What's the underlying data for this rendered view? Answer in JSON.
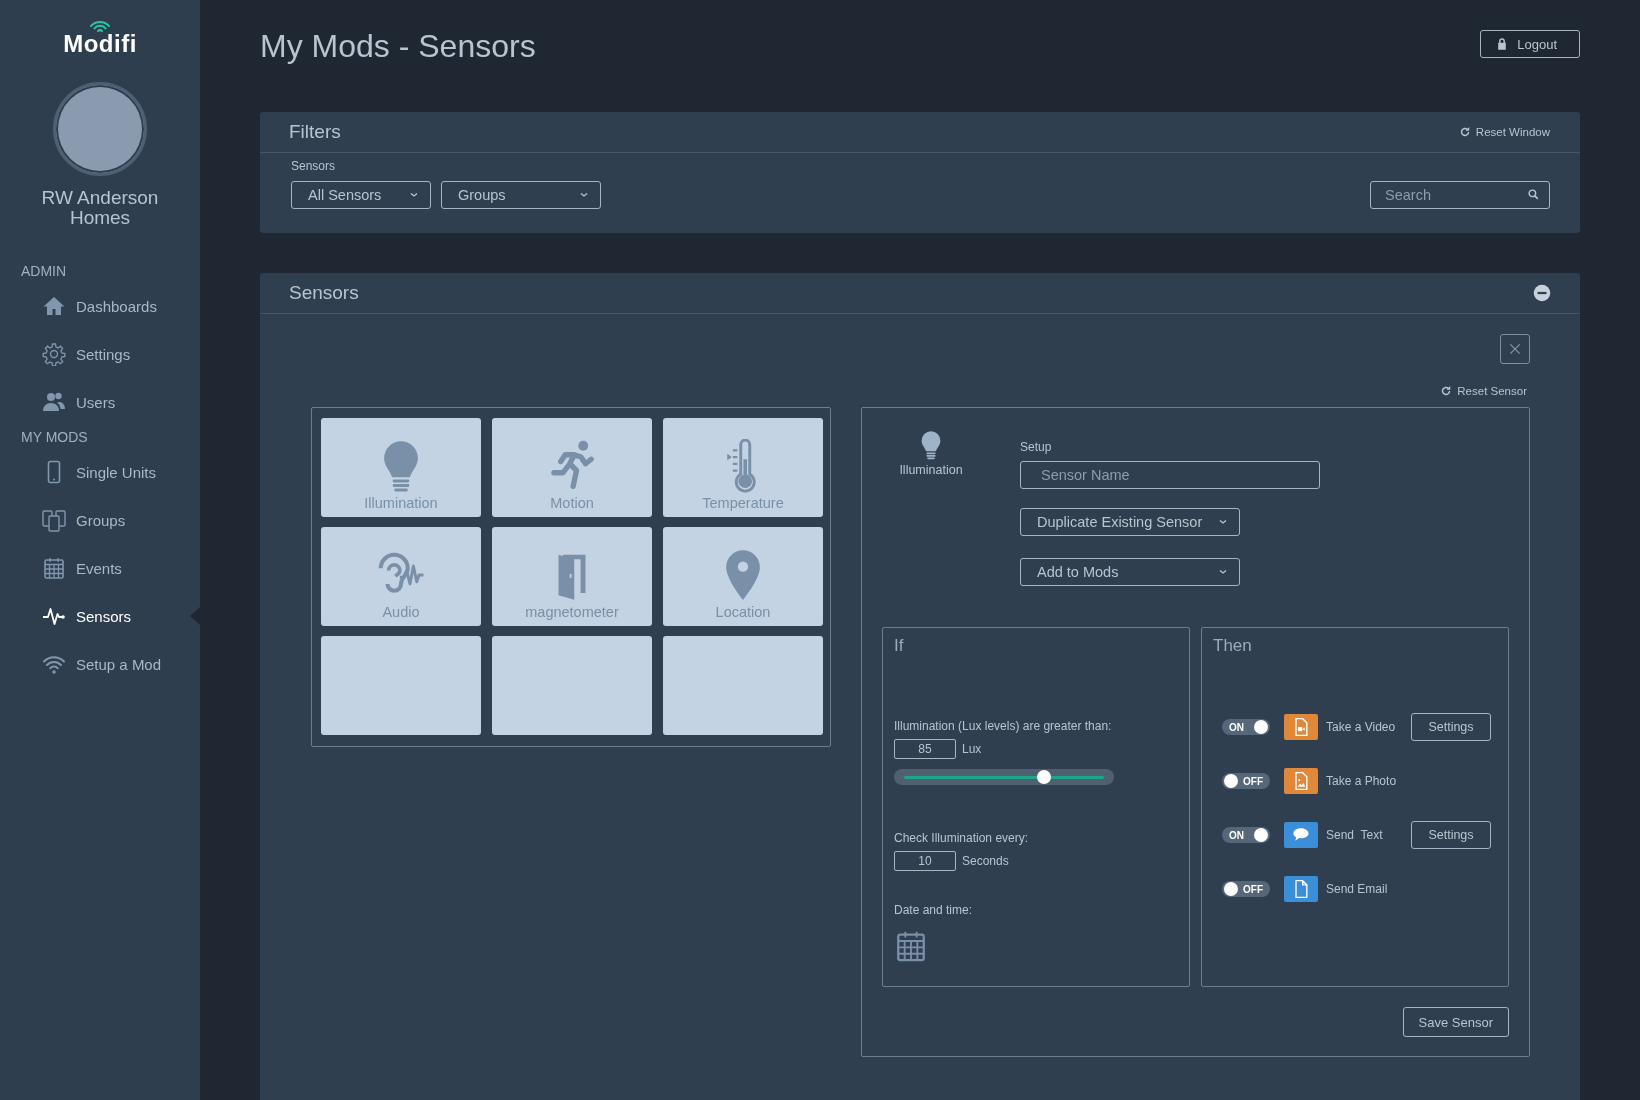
{
  "brand": "Modifi",
  "user": {
    "name": "RW Anderson Homes"
  },
  "nav": [
    {
      "heading": "ADMIN",
      "items": [
        {
          "label": "Dashboards",
          "selected": false
        },
        {
          "label": "Settings",
          "selected": false
        },
        {
          "label": "Users",
          "selected": false
        }
      ]
    },
    {
      "heading": "MY MODS",
      "items": [
        {
          "label": "Single Units",
          "selected": false
        },
        {
          "label": "Groups",
          "selected": false
        },
        {
          "label": "Events",
          "selected": false
        },
        {
          "label": "Sensors",
          "selected": true
        },
        {
          "label": "Setup a Mod",
          "selected": false
        }
      ]
    }
  ],
  "page_title": "My Mods - Sensors",
  "logout": "Logout",
  "filters": {
    "title": "Filters",
    "reset": "Reset Window",
    "label": "Sensors",
    "dropdowns": [
      "All Sensors",
      "Groups"
    ],
    "search": {
      "placeholder": "Search"
    }
  },
  "sensors_panel": {
    "title": "Sensors",
    "tiles": [
      {
        "kind": "sensor",
        "label": "Illumination"
      },
      {
        "kind": "sensor",
        "label": "Motion"
      },
      {
        "kind": "sensor",
        "label": "Temperature"
      },
      {
        "kind": "sensor",
        "label": "Audio"
      },
      {
        "kind": "sensor",
        "label": "magnetometer"
      },
      {
        "kind": "sensor",
        "label": "Location"
      },
      {
        "kind": "empty"
      },
      {
        "kind": "empty"
      },
      {
        "kind": "empty"
      }
    ]
  },
  "editor": {
    "reset": "Reset Sensor",
    "sensor": {
      "label": "Illumination"
    },
    "setup_label": "Setup",
    "name_field": {
      "placeholder": "Sensor Name"
    },
    "dropdowns": [
      "Duplicate Existing Sensor",
      "Add to Mods"
    ],
    "if": {
      "title": "If",
      "threshold_label": "Illumination (Lux levels) are greater than:",
      "threshold_value": "85",
      "threshold_unit": "Lux",
      "slider": {
        "level": 0.68
      },
      "interval_label": "Check Illumination every:",
      "interval_value": "10",
      "interval_unit": "Seconds",
      "date_label": "Date and time:"
    },
    "then": {
      "title": "Then",
      "actions": [
        {
          "on": true,
          "toggle_text": "ON",
          "color": "#e0883a",
          "label": "Take a Video",
          "settings": "Settings"
        },
        {
          "on": false,
          "toggle_text": "OFF",
          "color": "#e0883a",
          "label": "Take a Photo"
        },
        {
          "on": true,
          "toggle_text": "ON",
          "color": "#3a8fd8",
          "label": "Send  Text",
          "settings": "Settings"
        },
        {
          "on": false,
          "toggle_text": "OFF",
          "color": "#3a8fd8",
          "label": "Send Email"
        }
      ]
    },
    "save": "Save Sensor"
  }
}
